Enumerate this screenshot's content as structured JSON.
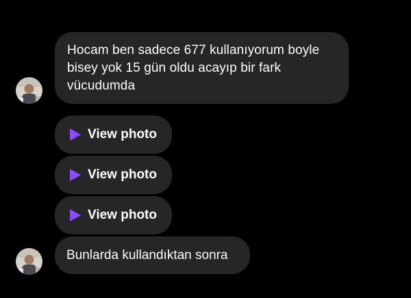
{
  "messages": {
    "first_text": "Hocam ben sadece 677 kullanıyorum boyle bisey yok 15 gün oldu acayıp bir fark vücudumda",
    "photos": [
      {
        "label": "View photo",
        "icon": "play-icon"
      },
      {
        "label": "View photo",
        "icon": "play-icon"
      },
      {
        "label": "View photo",
        "icon": "play-icon"
      }
    ],
    "last_text": "Bunlarda kullandıktan sonra"
  },
  "colors": {
    "background": "#000000",
    "bubble": "#262626",
    "accent": "#8a4dff"
  }
}
